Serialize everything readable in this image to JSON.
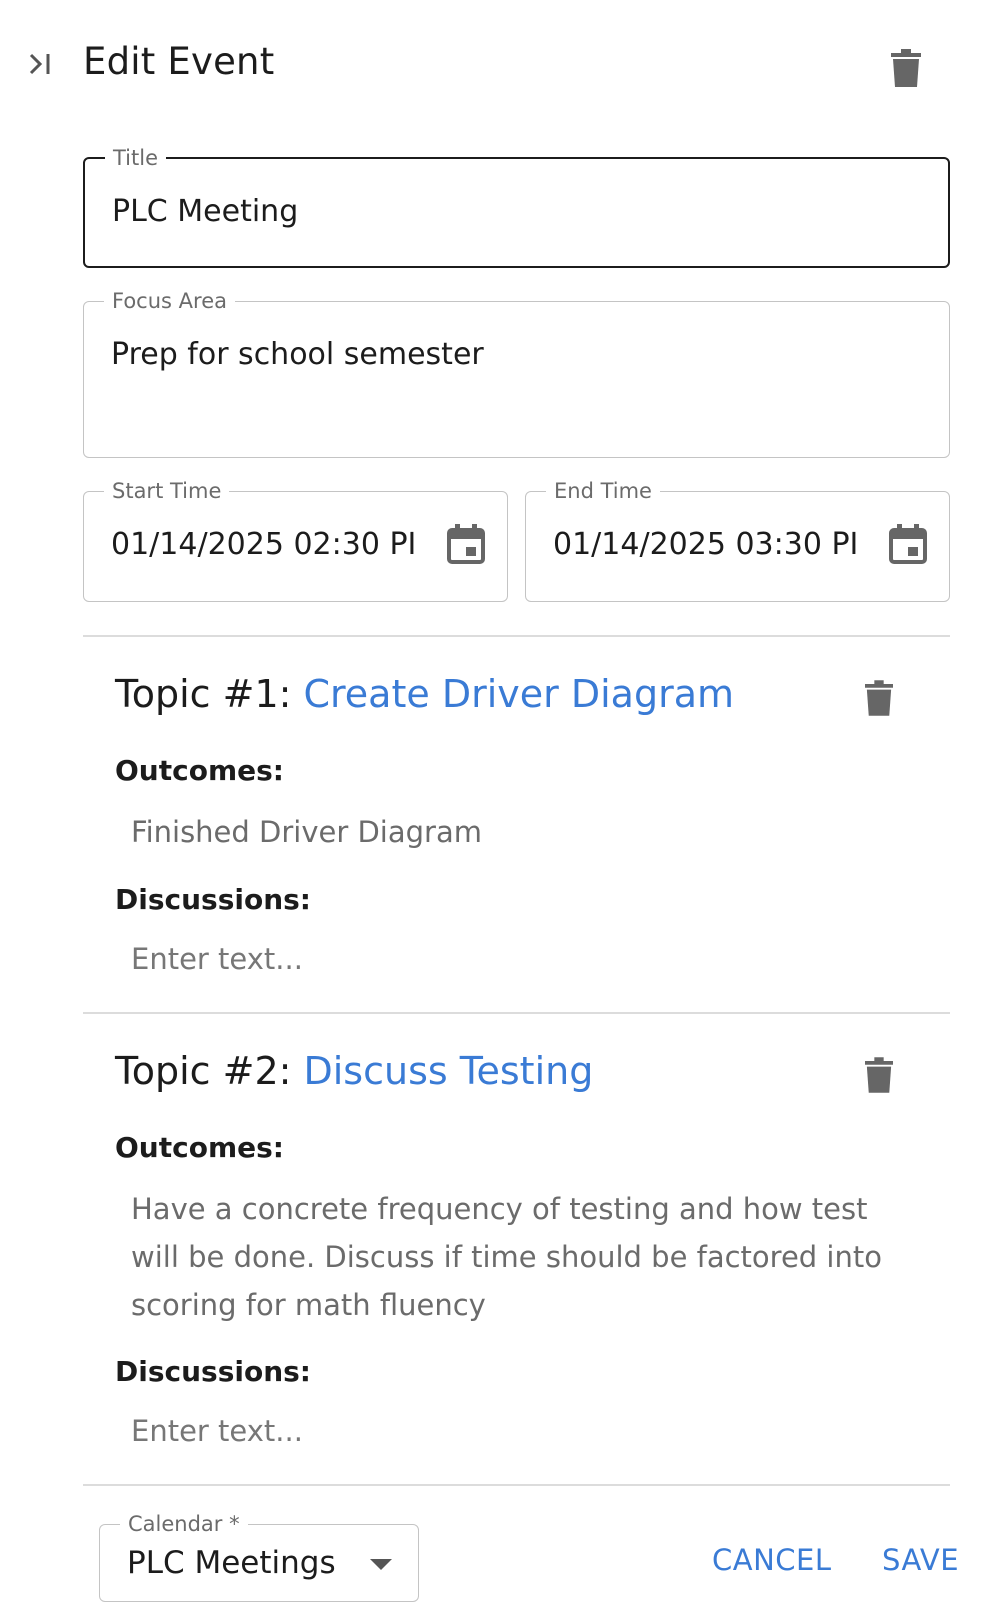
{
  "header": {
    "title": "Edit Event",
    "collapse_icon": "collapse-right-icon",
    "delete_icon": "trash-icon"
  },
  "form": {
    "title": {
      "label": "Title",
      "value": "PLC Meeting"
    },
    "focus_area": {
      "label": "Focus Area",
      "value": "Prep for school semester"
    },
    "start_time": {
      "label": "Start Time",
      "value": "01/14/2025 02:30 PI"
    },
    "end_time": {
      "label": "End Time",
      "value": "01/14/2025 03:30 PI"
    }
  },
  "topics": [
    {
      "number_label": "Topic #1:",
      "name": "Create Driver Diagram",
      "outcomes_label": "Outcomes:",
      "outcomes_text": "Finished Driver Diagram",
      "discussions_label": "Discussions:",
      "discussions_placeholder": "Enter text..."
    },
    {
      "number_label": "Topic #2:",
      "name": "Discuss Testing",
      "outcomes_label": "Outcomes:",
      "outcomes_text": "Have a concrete frequency of testing and how test will be done. Discuss if time should be factored into scoring for math fluency",
      "discussions_label": "Discussions:",
      "discussions_placeholder": "Enter text..."
    }
  ],
  "footer": {
    "calendar_label": "Calendar *",
    "calendar_value": "PLC Meetings",
    "cancel_label": "CANCEL",
    "save_label": "SAVE"
  },
  "colors": {
    "accent": "#3a7bd5",
    "icon": "#6b6b6b"
  }
}
